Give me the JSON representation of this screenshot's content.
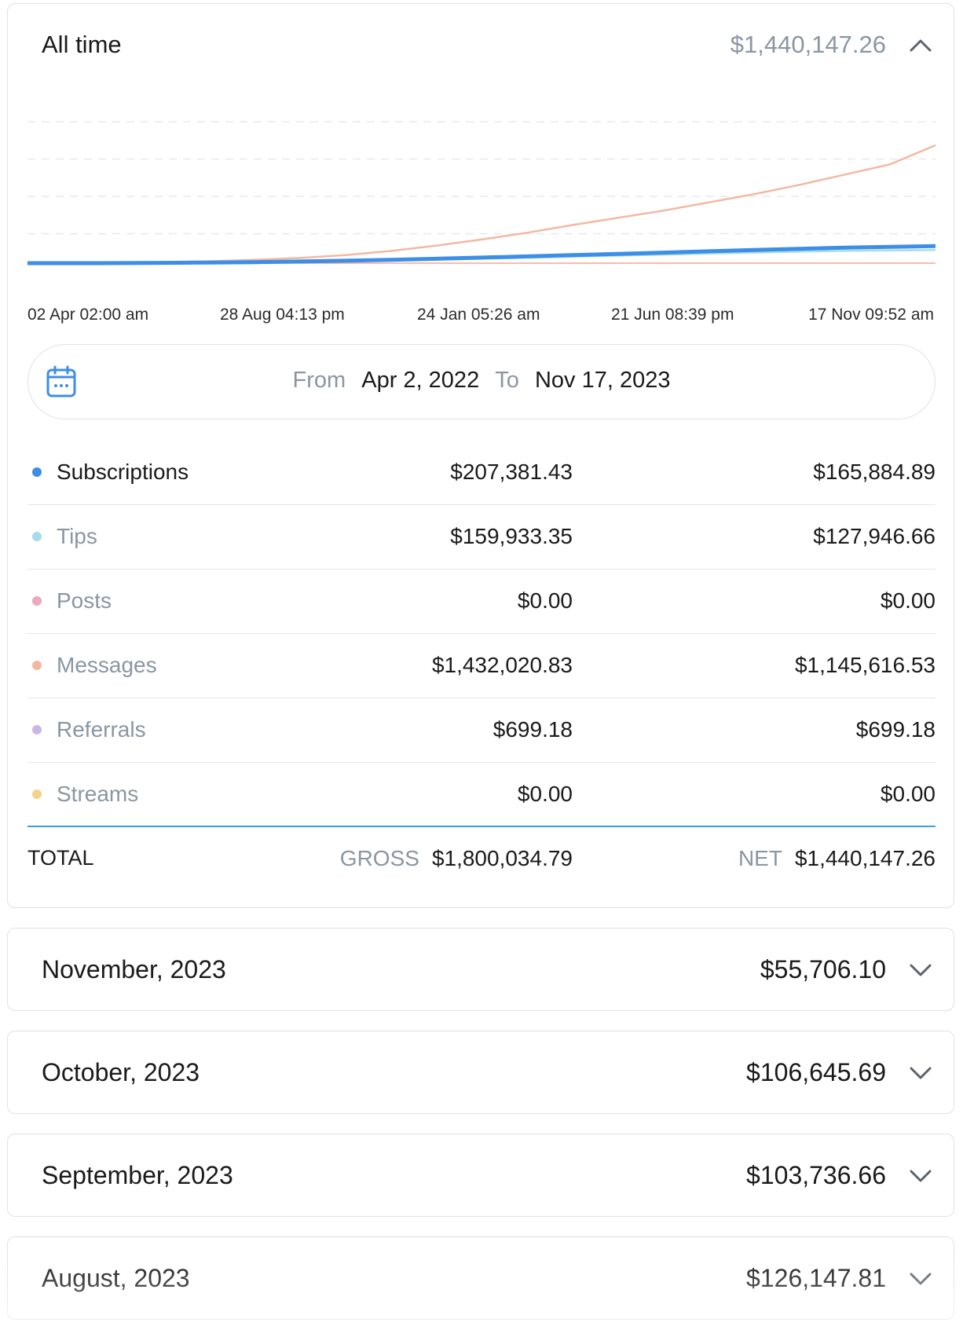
{
  "header": {
    "title": "All time",
    "total": "$1,440,147.26",
    "collapse_icon": "chevron-up-icon"
  },
  "chart_data": {
    "type": "line",
    "x_tick_labels": [
      "02 Apr 02:00 am",
      "28 Aug 04:13 pm",
      "24 Jan 05:26 am",
      "21 Jun 08:39 pm",
      "17 Nov 09:52 am"
    ],
    "y_range": [
      0,
      1450000
    ],
    "grid": "horizontal dashed",
    "x": [
      0,
      0.05,
      0.1,
      0.15,
      0.2,
      0.25,
      0.3,
      0.35,
      0.4,
      0.45,
      0.5,
      0.55,
      0.6,
      0.65,
      0.7,
      0.75,
      0.8,
      0.85,
      0.9,
      0.95,
      1.0
    ],
    "series": [
      {
        "color": "#f3b8a2",
        "values": [
          0,
          1000,
          4000,
          10000,
          18000,
          32000,
          50000,
          78000,
          118000,
          170000,
          230000,
          295000,
          370000,
          440000,
          510000,
          590000,
          670000,
          760000,
          860000,
          960000,
          1145616.53
        ]
      },
      {
        "color": "#3d8ee6",
        "values": [
          0,
          200,
          1000,
          3000,
          6000,
          10000,
          16000,
          24000,
          33000,
          43000,
          54000,
          66000,
          78000,
          90000,
          102000,
          115000,
          128000,
          140000,
          150000,
          158000,
          165884.89
        ]
      },
      {
        "color": "#a6dced",
        "values": [
          0,
          150,
          800,
          2500,
          5000,
          8500,
          13000,
          19000,
          26000,
          34000,
          43000,
          53000,
          63000,
          73000,
          83000,
          93000,
          103000,
          112000,
          119000,
          124000,
          127946.66
        ]
      },
      {
        "color": "#f2a596",
        "values": [
          0,
          0,
          0,
          0,
          0,
          0,
          0,
          0,
          0,
          0,
          0,
          0,
          0,
          0,
          0,
          0,
          0,
          0,
          0,
          0,
          0
        ]
      }
    ]
  },
  "date_range": {
    "from_label": "From",
    "from_value": "Apr 2, 2022",
    "to_label": "To",
    "to_value": "Nov 17, 2023",
    "icon": "calendar-icon"
  },
  "breakdown": [
    {
      "label": "Subscriptions",
      "color": "#3d8ee6",
      "gross": "$207,381.43",
      "net": "$165,884.89",
      "active": true
    },
    {
      "label": "Tips",
      "color": "#a6dced",
      "gross": "$159,933.35",
      "net": "$127,946.66",
      "active": false
    },
    {
      "label": "Posts",
      "color": "#eda6bf",
      "gross": "$0.00",
      "net": "$0.00",
      "active": false
    },
    {
      "label": "Messages",
      "color": "#f3b8a2",
      "gross": "$1,432,020.83",
      "net": "$1,145,616.53",
      "active": false
    },
    {
      "label": "Referrals",
      "color": "#c9b6e4",
      "gross": "$699.18",
      "net": "$699.18",
      "active": false
    },
    {
      "label": "Streams",
      "color": "#f7d08a",
      "gross": "$0.00",
      "net": "$0.00",
      "active": false
    }
  ],
  "total": {
    "label": "TOTAL",
    "gross_caption": "GROSS",
    "gross": "$1,800,034.79",
    "net_caption": "NET",
    "net": "$1,440,147.26"
  },
  "months": [
    {
      "title": "November, 2023",
      "amount": "$55,706.10"
    },
    {
      "title": "October, 2023",
      "amount": "$106,645.69"
    },
    {
      "title": "September, 2023",
      "amount": "$103,736.66"
    },
    {
      "title": "August, 2023",
      "amount": "$126,147.81"
    }
  ],
  "colors": {
    "accent": "#3aa0d8",
    "muted_text": "#8a96a3",
    "border": "#dfe2e6"
  }
}
